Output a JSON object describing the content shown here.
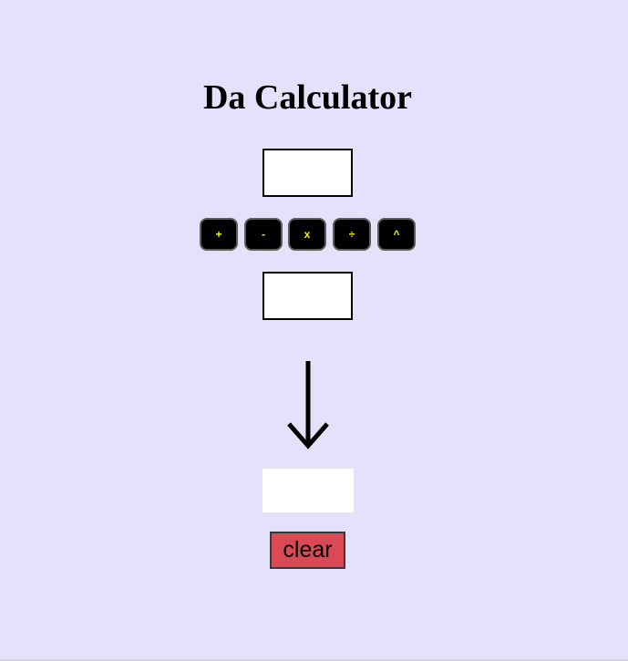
{
  "page": {
    "title": "Da Calculator"
  },
  "inputs": {
    "first_value": "",
    "second_value": ""
  },
  "operators": [
    {
      "label": "+",
      "name": "add"
    },
    {
      "label": "-",
      "name": "subtract"
    },
    {
      "label": "x",
      "name": "multiply"
    },
    {
      "label": "÷",
      "name": "divide"
    },
    {
      "label": "^",
      "name": "power"
    }
  ],
  "result": {
    "value": ""
  },
  "clear_button": {
    "label": "clear"
  },
  "colors": {
    "background": "#e6e1fa",
    "operator_button": "#000000",
    "operator_text": "#f5f500",
    "clear_button": "#d94a55"
  },
  "icons": {
    "arrow": "arrow-down-icon"
  }
}
